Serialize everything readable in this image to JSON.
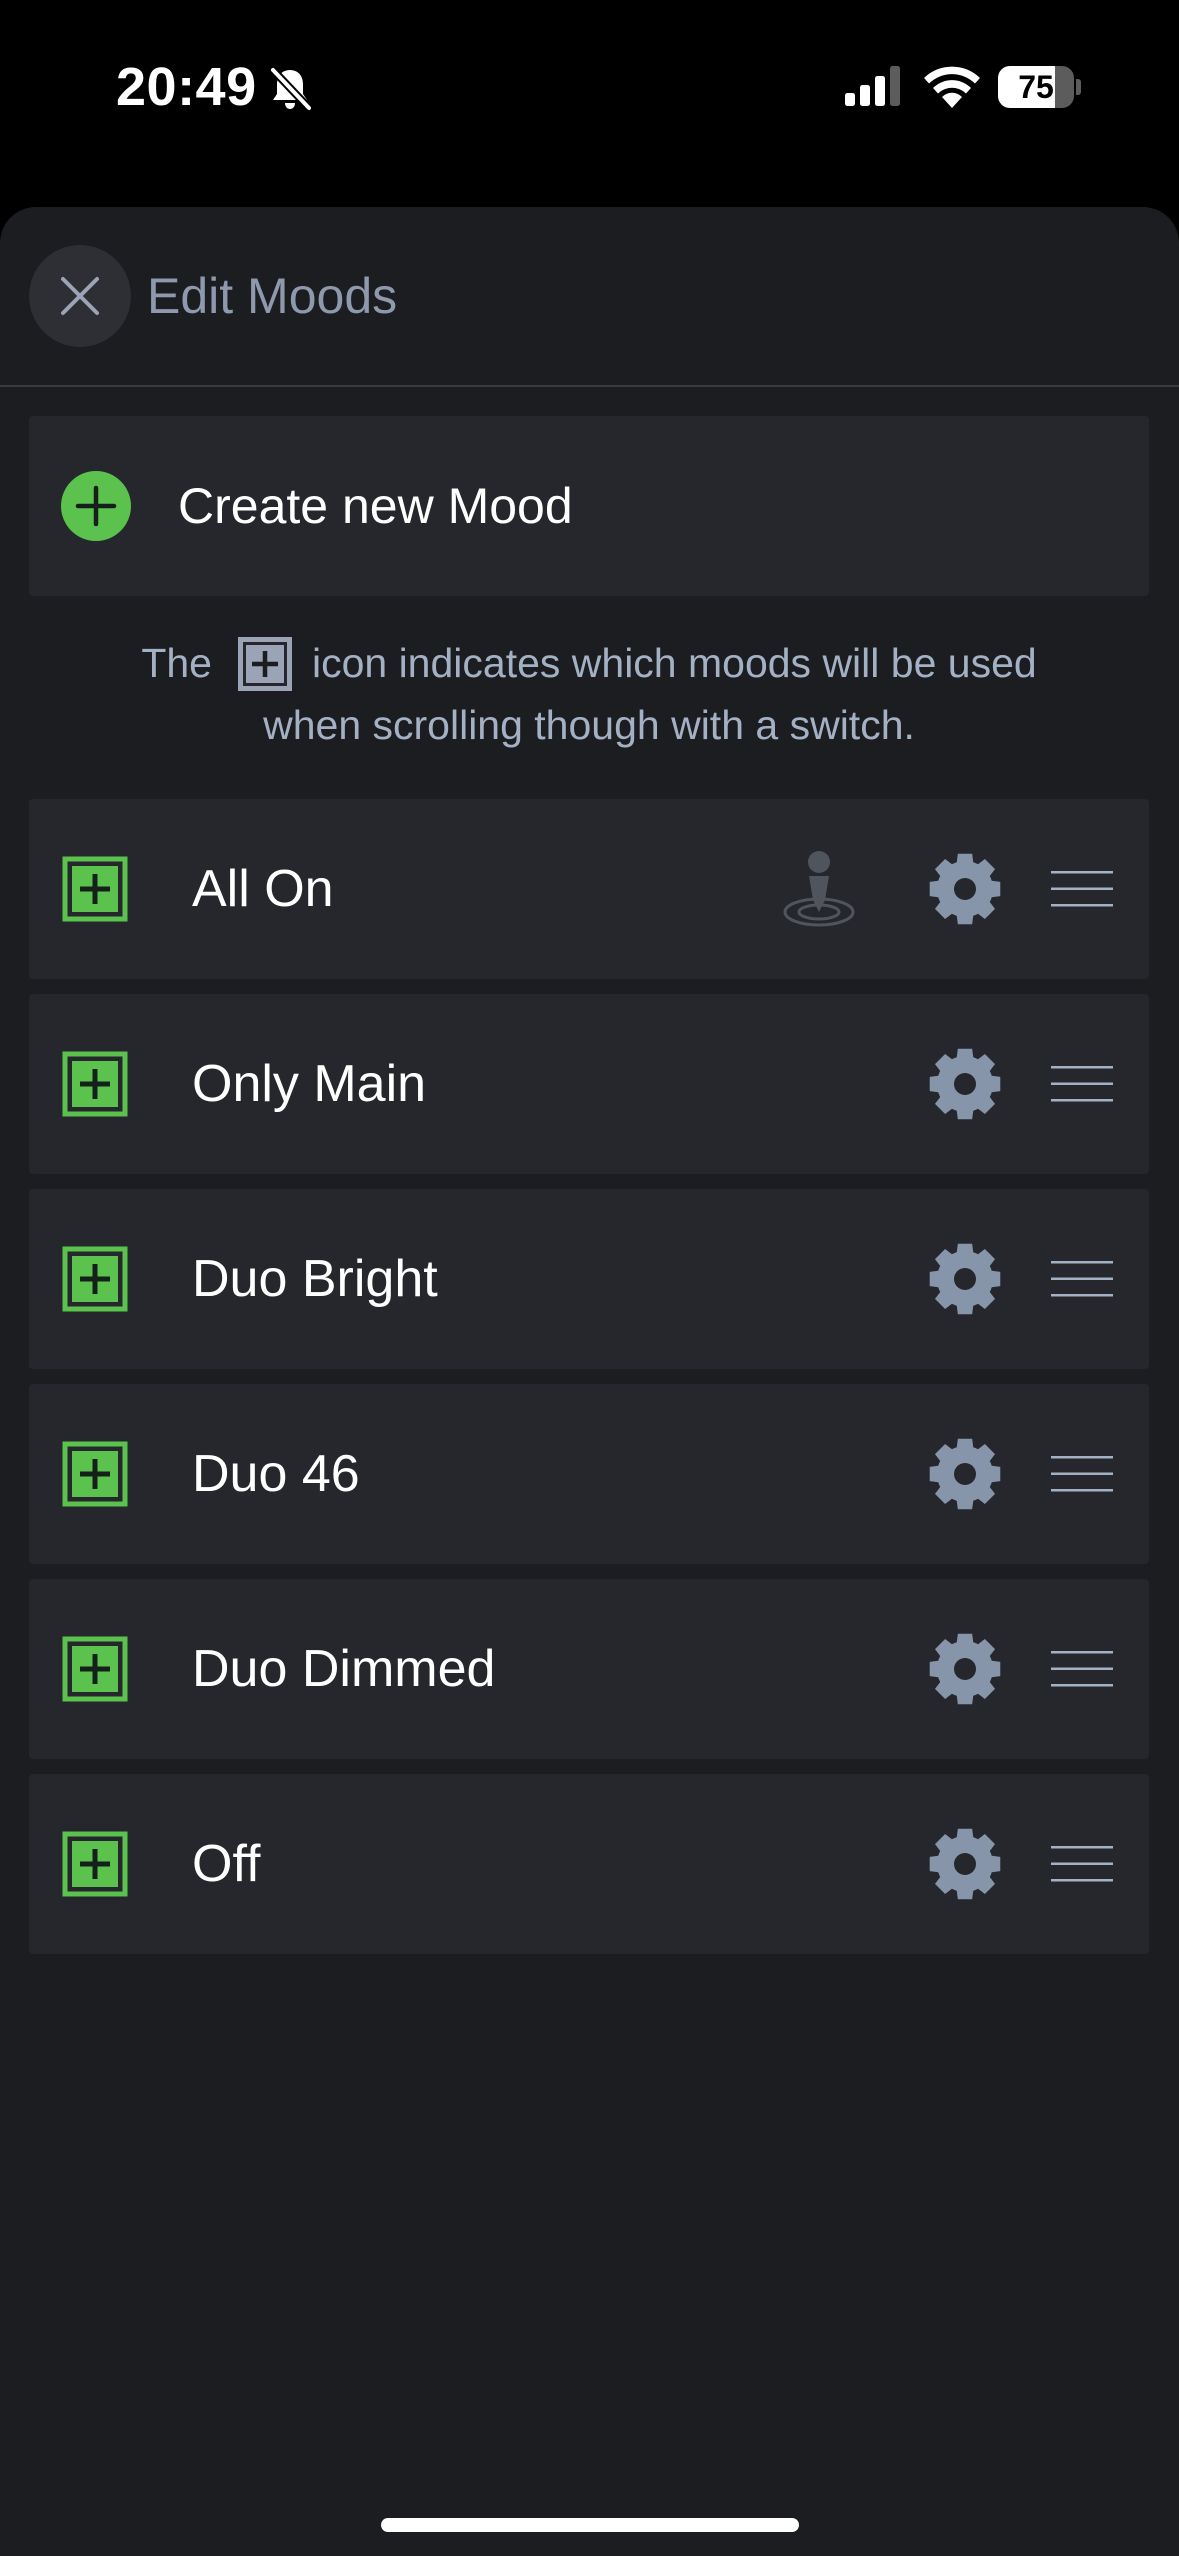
{
  "status_bar": {
    "time": "20:49",
    "battery_percent": "75",
    "battery_level": 0.75,
    "icons": [
      "bell-slash-icon",
      "cellular-signal-icon",
      "wifi-icon",
      "battery-icon"
    ]
  },
  "header": {
    "close_icon": "close-icon",
    "title": "Edit Moods"
  },
  "create": {
    "icon": "plus-circle-icon",
    "label": "Create new Mood"
  },
  "info": {
    "prefix": "The",
    "icon": "plus-square-icon",
    "suffix": "icon indicates which moods will be used",
    "line2": "when scrolling though with a switch."
  },
  "moods": [
    {
      "name": "All On",
      "in_switch_cycle": true,
      "switch_default": true
    },
    {
      "name": "Only Main",
      "in_switch_cycle": true,
      "switch_default": false
    },
    {
      "name": "Duo Bright",
      "in_switch_cycle": true,
      "switch_default": false
    },
    {
      "name": "Duo 46",
      "in_switch_cycle": true,
      "switch_default": false
    },
    {
      "name": "Duo Dimmed",
      "in_switch_cycle": true,
      "switch_default": false
    },
    {
      "name": "Off",
      "in_switch_cycle": true,
      "switch_default": false
    }
  ],
  "mood_row_icons": [
    "plus-square-icon",
    "switch-marker-icon",
    "gear-icon",
    "drag-handle-icon"
  ],
  "colors": {
    "background": "#000000",
    "sheet": "#1c1d20",
    "row": "#25272c",
    "accent_green": "#5bc24e",
    "muted_text": "#8e99ad",
    "gear": "#8795ab"
  }
}
